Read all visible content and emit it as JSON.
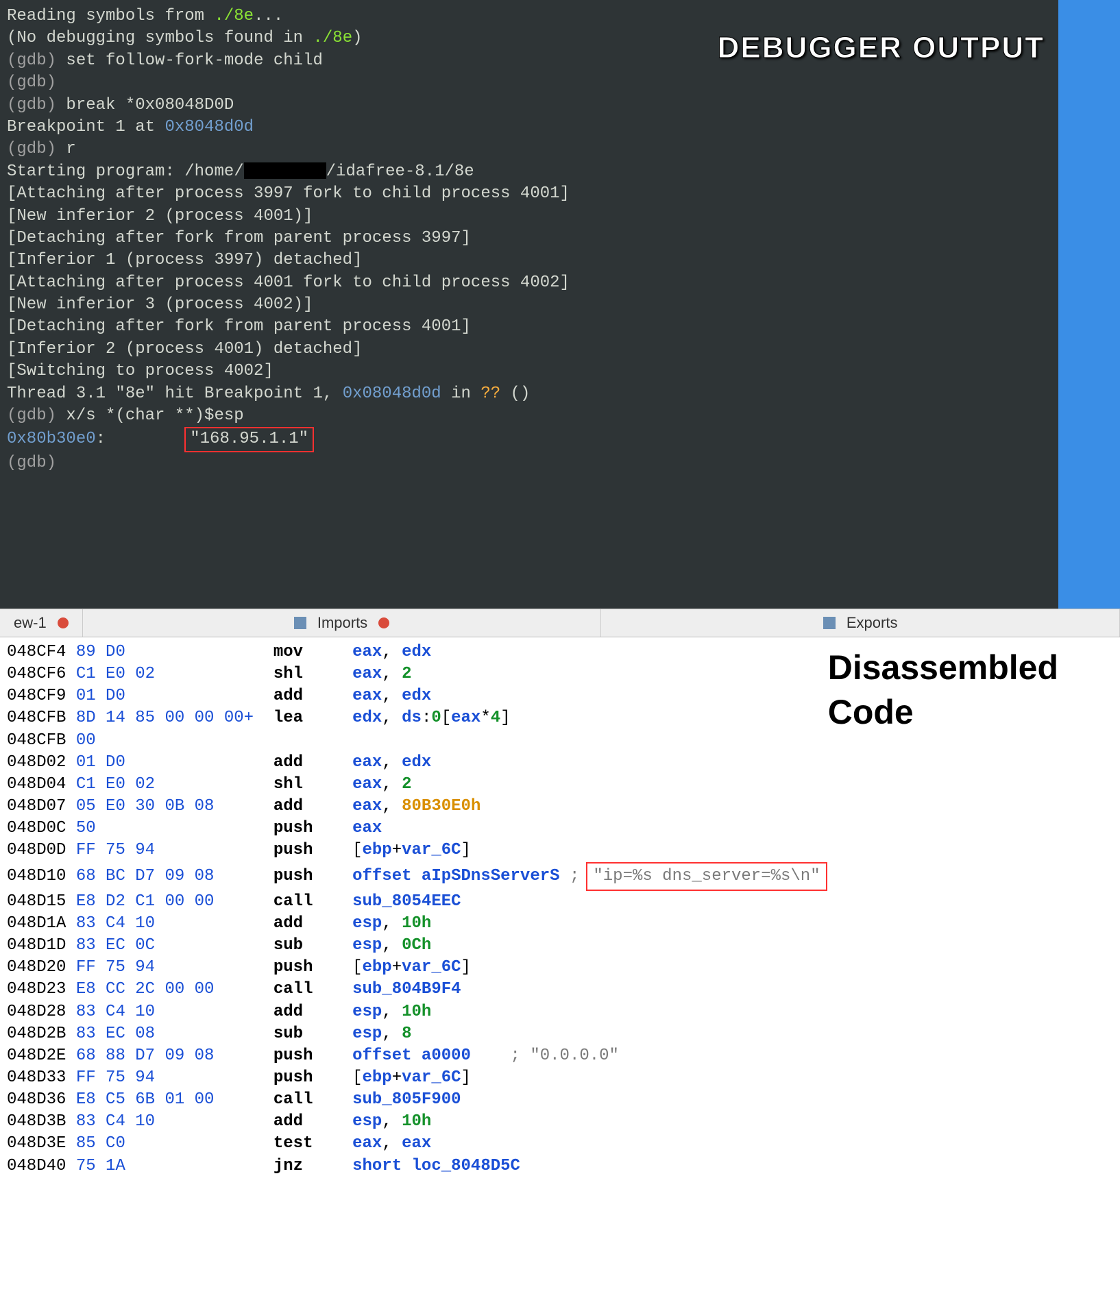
{
  "labels": {
    "debugger": "DEBUGGER OUTPUT",
    "disasm_l1": "Disassembled",
    "disasm_l2": "Code"
  },
  "tabs": {
    "left": "ew-1",
    "center": "Imports",
    "right": "Exports"
  },
  "gdb": {
    "l01a": "Reading symbols from ",
    "l01b": "./8e",
    "l01c": "...",
    "l02a": "(No debugging symbols found in ",
    "l02b": "./8e",
    "l02c": ")",
    "l03a": "(gdb) ",
    "l03b": "set follow-fork-mode child",
    "l04": "(gdb)",
    "l05a": "(gdb) ",
    "l05b": "break *0x08048D0D",
    "l06a": "Breakpoint 1 at ",
    "l06b": "0x8048d0d",
    "l07a": "(gdb) ",
    "l07b": "r",
    "l08a": "Starting program: /home/",
    "l08b": "/idafree-8.1/8e",
    "l09": "[Attaching after process 3997 fork to child process 4001]",
    "l10": "[New inferior 2 (process 4001)]",
    "l11": "[Detaching after fork from parent process 3997]",
    "l12": "[Inferior 1 (process 3997) detached]",
    "l13": "[Attaching after process 4001 fork to child process 4002]",
    "l14": "[New inferior 3 (process 4002)]",
    "l15": "[Detaching after fork from parent process 4001]",
    "l16": "[Inferior 2 (process 4001) detached]",
    "l17": "[Switching to process 4002]",
    "l18": "",
    "l19a": "Thread 3.1 \"8e\" hit Breakpoint 1, ",
    "l19b": "0x08048d0d",
    "l19c": " in ",
    "l19d": "??",
    "l19e": " ()",
    "l20a": "(gdb) ",
    "l20b": "x/s *(char **)$esp",
    "l21a": "0x80b30e0",
    "l21b": ":        ",
    "l21c": "\"168.95.1.1\"",
    "l22": "(gdb)"
  },
  "disasm": {
    "annot_box": "\"ip=%s dns_server=%s\\n\"",
    "rows": [
      {
        "addr": "048CF4",
        "bytes": "89 D0",
        "mnem": "mov",
        "operands": [
          [
            "reg",
            "eax"
          ],
          [
            "sep",
            ", "
          ],
          [
            "reg",
            "edx"
          ]
        ]
      },
      {
        "addr": "048CF6",
        "bytes": "C1 E0 02",
        "mnem": "shl",
        "operands": [
          [
            "reg",
            "eax"
          ],
          [
            "sep",
            ", "
          ],
          [
            "num",
            "2"
          ]
        ]
      },
      {
        "addr": "048CF9",
        "bytes": "01 D0",
        "mnem": "add",
        "operands": [
          [
            "reg",
            "eax"
          ],
          [
            "sep",
            ", "
          ],
          [
            "reg",
            "edx"
          ]
        ]
      },
      {
        "addr": "048CFB",
        "bytes": "8D 14 85 00 00 00+",
        "mnem": "lea",
        "operands": [
          [
            "reg",
            "edx"
          ],
          [
            "sep",
            ", "
          ],
          [
            "reg",
            "ds"
          ],
          [
            "sep",
            ":"
          ],
          [
            "num",
            "0"
          ],
          [
            "sep",
            "["
          ],
          [
            "reg",
            "eax"
          ],
          [
            "sep",
            "*"
          ],
          [
            "num",
            "4"
          ],
          [
            "sep",
            "]"
          ]
        ]
      },
      {
        "addr": "048CFB",
        "bytes": "00",
        "mnem": "",
        "operands": []
      },
      {
        "addr": "048D02",
        "bytes": "01 D0",
        "mnem": "add",
        "operands": [
          [
            "reg",
            "eax"
          ],
          [
            "sep",
            ", "
          ],
          [
            "reg",
            "edx"
          ]
        ]
      },
      {
        "addr": "048D04",
        "bytes": "C1 E0 02",
        "mnem": "shl",
        "operands": [
          [
            "reg",
            "eax"
          ],
          [
            "sep",
            ", "
          ],
          [
            "num",
            "2"
          ]
        ]
      },
      {
        "addr": "048D07",
        "bytes": "05 E0 30 0B 08",
        "mnem": "add",
        "operands": [
          [
            "reg",
            "eax"
          ],
          [
            "sep",
            ", "
          ],
          [
            "hex",
            "80B30E0h"
          ]
        ]
      },
      {
        "addr": "048D0C",
        "bytes": "50",
        "mnem": "push",
        "operands": [
          [
            "reg",
            "eax"
          ]
        ]
      },
      {
        "addr": "048D0D",
        "bytes": "FF 75 94",
        "mnem": "push",
        "operands": [
          [
            "sep",
            "["
          ],
          [
            "reg",
            "ebp"
          ],
          [
            "sep",
            "+"
          ],
          [
            "sym",
            "var_6C"
          ],
          [
            "sep",
            "]"
          ]
        ]
      },
      {
        "addr": "048D10",
        "bytes": "68 BC D7 09 08",
        "mnem": "push",
        "operands": [
          [
            "sym",
            "offset aIpSDnsServerS"
          ]
        ],
        "comment": " ;",
        "annot": true
      },
      {
        "addr": "048D15",
        "bytes": "E8 D2 C1 00 00",
        "mnem": "call",
        "operands": [
          [
            "sym",
            "sub_8054EEC"
          ]
        ]
      },
      {
        "addr": "048D1A",
        "bytes": "83 C4 10",
        "mnem": "add",
        "operands": [
          [
            "reg",
            "esp"
          ],
          [
            "sep",
            ", "
          ],
          [
            "num",
            "10h"
          ]
        ]
      },
      {
        "addr": "048D1D",
        "bytes": "83 EC 0C",
        "mnem": "sub",
        "operands": [
          [
            "reg",
            "esp"
          ],
          [
            "sep",
            ", "
          ],
          [
            "num",
            "0Ch"
          ]
        ]
      },
      {
        "addr": "048D20",
        "bytes": "FF 75 94",
        "mnem": "push",
        "operands": [
          [
            "sep",
            "["
          ],
          [
            "reg",
            "ebp"
          ],
          [
            "sep",
            "+"
          ],
          [
            "sym",
            "var_6C"
          ],
          [
            "sep",
            "]"
          ]
        ]
      },
      {
        "addr": "048D23",
        "bytes": "E8 CC 2C 00 00",
        "mnem": "call",
        "operands": [
          [
            "sym",
            "sub_804B9F4"
          ]
        ]
      },
      {
        "addr": "048D28",
        "bytes": "83 C4 10",
        "mnem": "add",
        "operands": [
          [
            "reg",
            "esp"
          ],
          [
            "sep",
            ", "
          ],
          [
            "num",
            "10h"
          ]
        ]
      },
      {
        "addr": "048D2B",
        "bytes": "83 EC 08",
        "mnem": "sub",
        "operands": [
          [
            "reg",
            "esp"
          ],
          [
            "sep",
            ", "
          ],
          [
            "num",
            "8"
          ]
        ]
      },
      {
        "addr": "048D2E",
        "bytes": "68 88 D7 09 08",
        "mnem": "push",
        "operands": [
          [
            "sym",
            "offset a0000"
          ]
        ],
        "comment": "    ; \"0.0.0.0\""
      },
      {
        "addr": "048D33",
        "bytes": "FF 75 94",
        "mnem": "push",
        "operands": [
          [
            "sep",
            "["
          ],
          [
            "reg",
            "ebp"
          ],
          [
            "sep",
            "+"
          ],
          [
            "sym",
            "var_6C"
          ],
          [
            "sep",
            "]"
          ]
        ]
      },
      {
        "addr": "048D36",
        "bytes": "E8 C5 6B 01 00",
        "mnem": "call",
        "operands": [
          [
            "sym",
            "sub_805F900"
          ]
        ]
      },
      {
        "addr": "048D3B",
        "bytes": "83 C4 10",
        "mnem": "add",
        "operands": [
          [
            "reg",
            "esp"
          ],
          [
            "sep",
            ", "
          ],
          [
            "num",
            "10h"
          ]
        ]
      },
      {
        "addr": "048D3E",
        "bytes": "85 C0",
        "mnem": "test",
        "operands": [
          [
            "reg",
            "eax"
          ],
          [
            "sep",
            ", "
          ],
          [
            "reg",
            "eax"
          ]
        ]
      },
      {
        "addr": "048D40",
        "bytes": "75 1A",
        "mnem": "jnz",
        "operands": [
          [
            "sym",
            "short loc_8048D5C"
          ]
        ]
      }
    ]
  }
}
